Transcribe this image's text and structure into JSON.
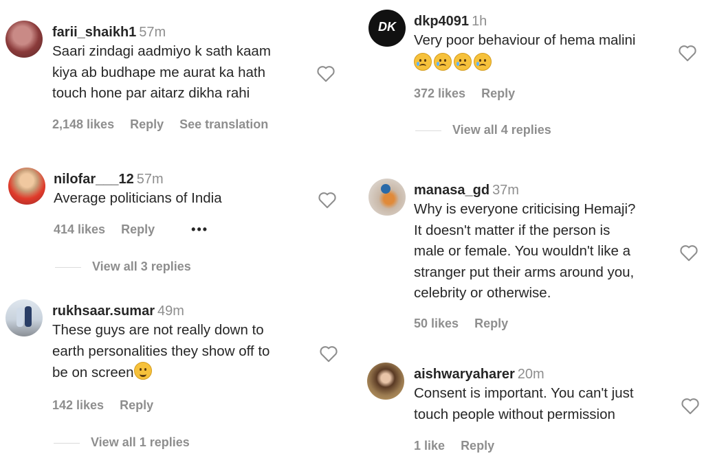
{
  "comments_left": [
    {
      "username": "farii_shaikh1",
      "time": "57m",
      "lines": [
        "Saari zindagi aadmiyo k sath kaam",
        "kiya ab budhape me aurat ka hath",
        "touch hone par aitarz dikha rahi"
      ],
      "likes": "2,148 likes",
      "reply": "Reply",
      "extra": "See translation"
    },
    {
      "username": "nilofar___12",
      "time": "57m",
      "lines": [
        "Average politicians of India"
      ],
      "likes": "414 likes",
      "reply": "Reply",
      "extra": "•••",
      "view_replies": "View all 3 replies"
    },
    {
      "username": "rukhsaar.sumar",
      "time": "49m",
      "lines": [
        "These guys are not really down to",
        "earth personalities they show off to",
        "be on screen"
      ],
      "likes": "142 likes",
      "reply": "Reply",
      "view_replies": "View all 1 replies"
    }
  ],
  "comments_right": [
    {
      "username": "dkp4091",
      "time": "1h",
      "avatar_text": "DK",
      "lines": [
        "Very poor behaviour of hema malini"
      ],
      "likes": "372 likes",
      "reply": "Reply",
      "view_replies": "View all 4 replies"
    },
    {
      "username": "manasa_gd",
      "time": "37m",
      "lines": [
        "Why is everyone criticising Hemaji?",
        "It doesn't matter if the person is",
        "male or female. You wouldn't like a",
        "stranger put their arms around you,",
        "celebrity or otherwise."
      ],
      "likes": "50 likes",
      "reply": "Reply"
    },
    {
      "username": "aishwaryaharer",
      "time": "20m",
      "lines": [
        "Consent is important. You can't just",
        "touch people without permission"
      ],
      "likes": "1 like",
      "reply": "Reply"
    }
  ],
  "colors": {
    "text": "#262626",
    "muted": "#8e8e8e",
    "emoji": "#f6c13b"
  },
  "icons": {
    "like": "heart-outline-icon",
    "emoji_laugh": "face-with-tears-of-joy",
    "emoji_cry": "crying-face"
  }
}
